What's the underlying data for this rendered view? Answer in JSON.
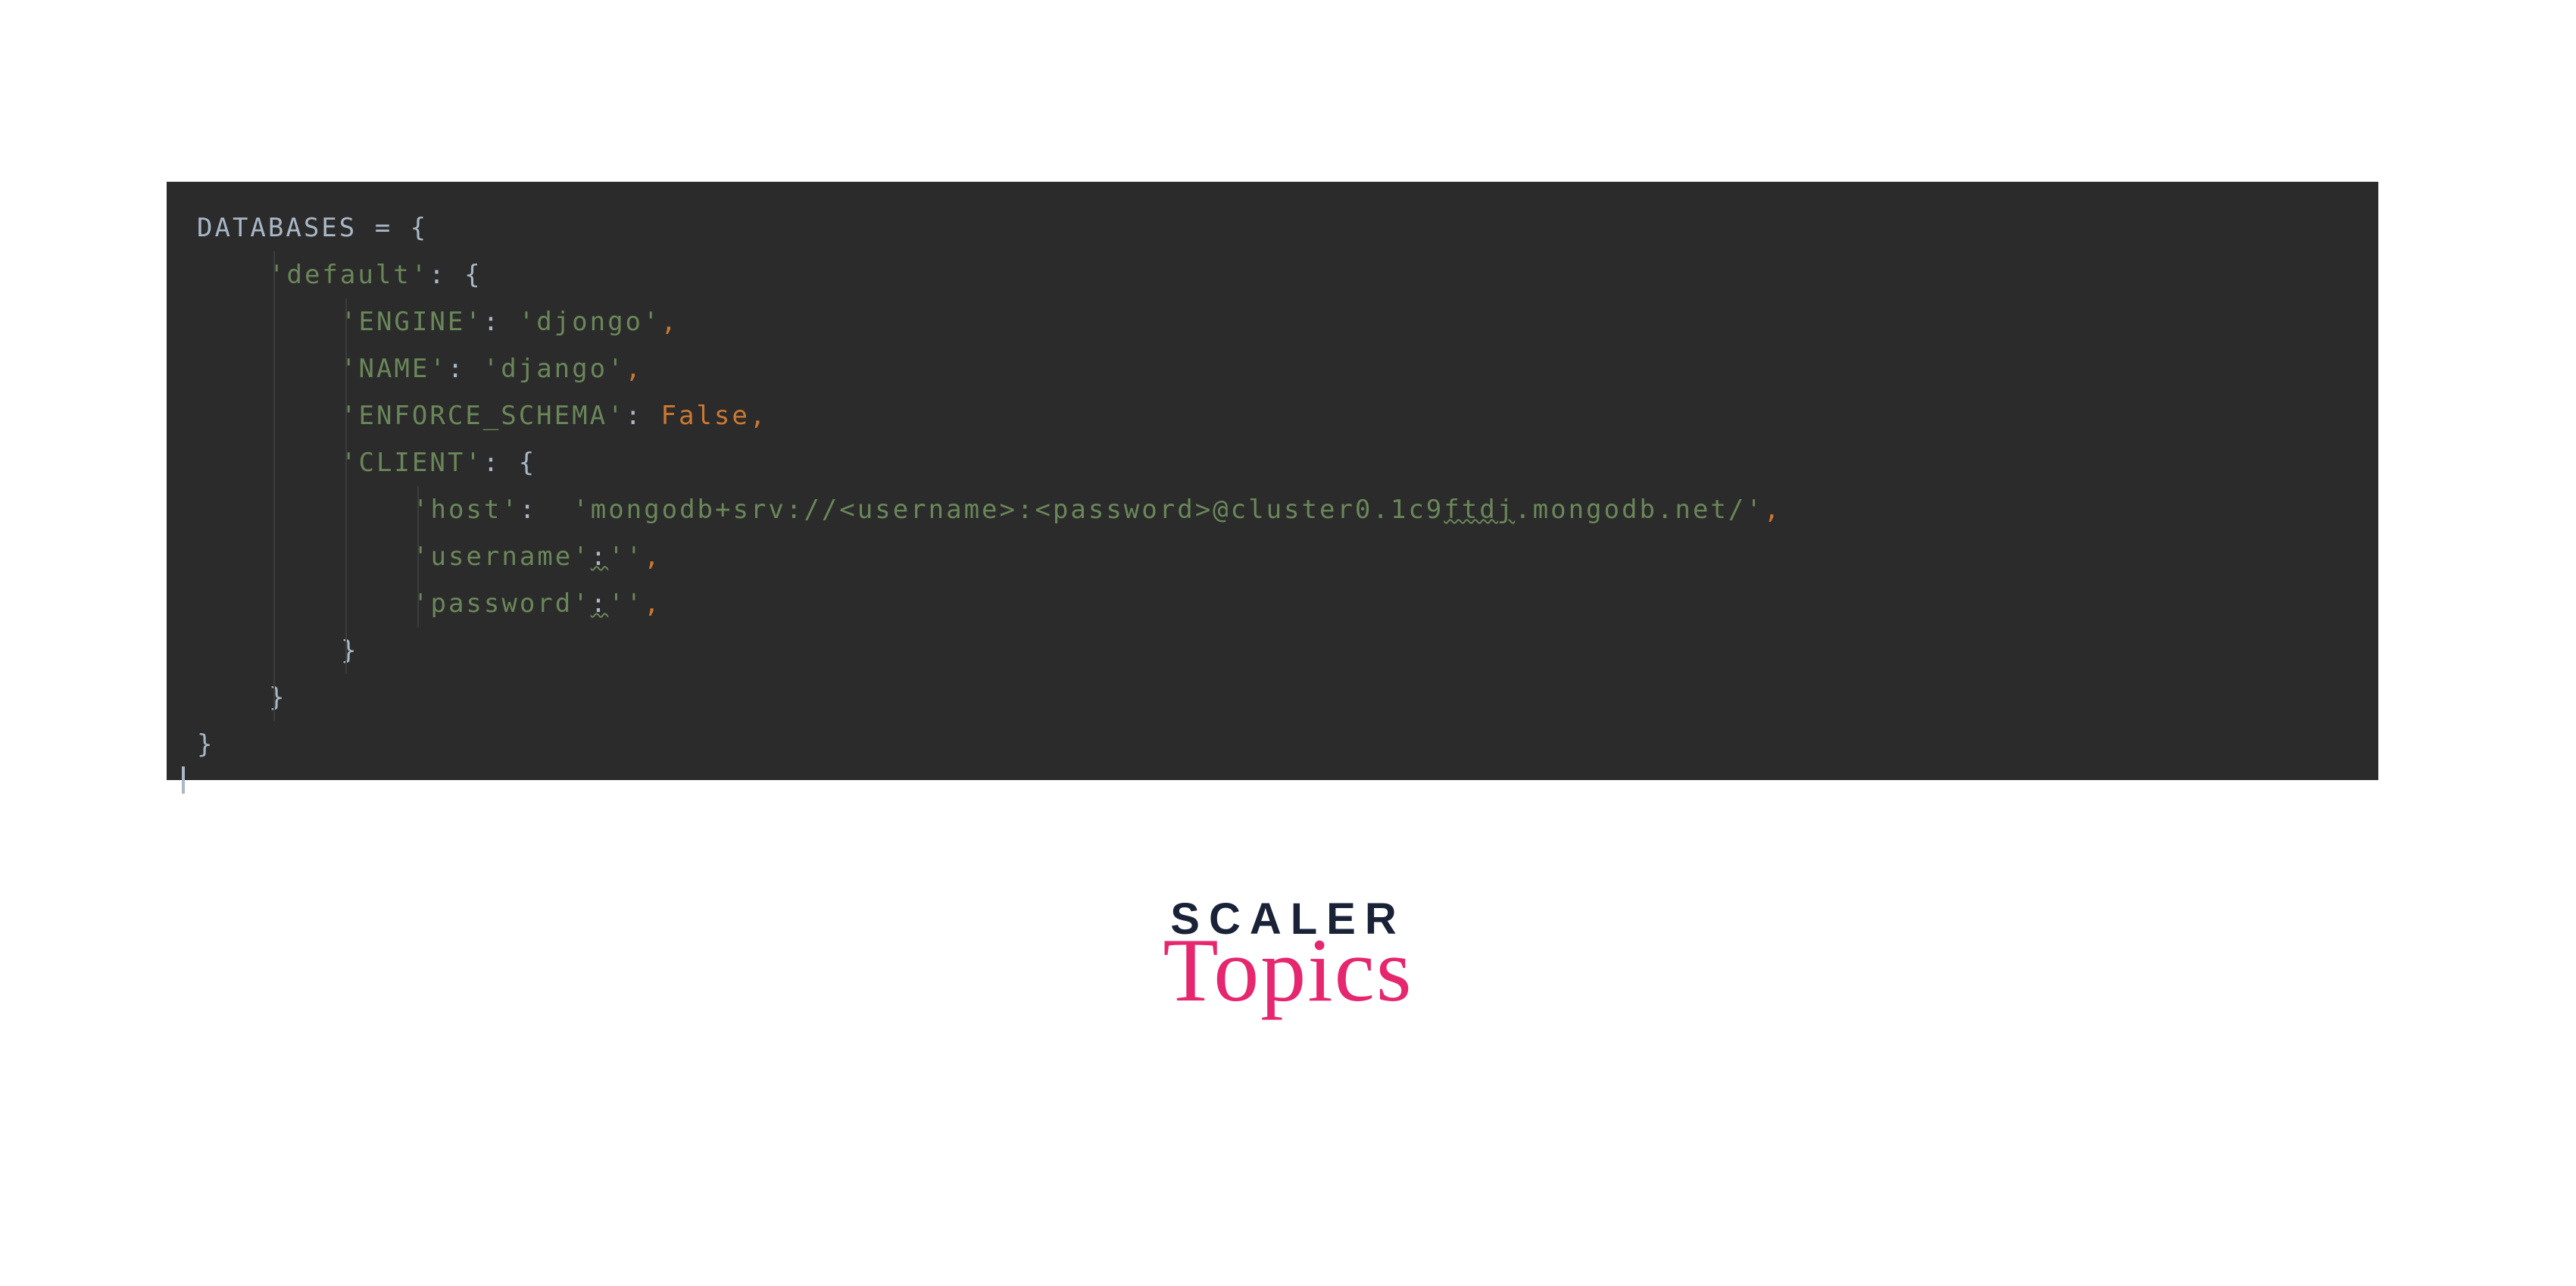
{
  "code": {
    "lines": [
      {
        "indent": 0,
        "segments": [
          {
            "cls": "tok-default",
            "text": "DATABASES = {"
          }
        ]
      },
      {
        "indent": 1,
        "segments": [
          {
            "cls": "tok-string",
            "text": "'default'"
          },
          {
            "cls": "tok-default",
            "text": ": {"
          }
        ]
      },
      {
        "indent": 2,
        "segments": [
          {
            "cls": "tok-string",
            "text": "'ENGINE'"
          },
          {
            "cls": "tok-default",
            "text": ": "
          },
          {
            "cls": "tok-string",
            "text": "'djongo'"
          },
          {
            "cls": "tok-keyword",
            "text": ","
          }
        ]
      },
      {
        "indent": 2,
        "segments": [
          {
            "cls": "tok-string",
            "text": "'NAME'"
          },
          {
            "cls": "tok-default",
            "text": ": "
          },
          {
            "cls": "tok-string",
            "text": "'django'"
          },
          {
            "cls": "tok-keyword",
            "text": ","
          }
        ]
      },
      {
        "indent": 2,
        "segments": [
          {
            "cls": "tok-string",
            "text": "'ENFORCE_SCHEMA'"
          },
          {
            "cls": "tok-default",
            "text": ": "
          },
          {
            "cls": "tok-keyword",
            "text": "False,"
          }
        ]
      },
      {
        "indent": 2,
        "segments": [
          {
            "cls": "tok-string",
            "text": "'CLIENT'"
          },
          {
            "cls": "tok-default",
            "text": ": {"
          }
        ]
      },
      {
        "indent": 3,
        "segments": [
          {
            "cls": "tok-string",
            "text": "'host'"
          },
          {
            "cls": "tok-default",
            "text": ":  "
          },
          {
            "cls": "tok-string",
            "text": "'mongodb+srv://<username>:<password>@cluster0.1c9"
          },
          {
            "cls": "tok-string underline-wavy",
            "text": "ftdj"
          },
          {
            "cls": "tok-string",
            "text": ".mongodb.net/'"
          },
          {
            "cls": "tok-keyword",
            "text": ","
          }
        ]
      },
      {
        "indent": 3,
        "segments": [
          {
            "cls": "tok-string",
            "text": "'username'"
          },
          {
            "cls": "tok-default underline-wavy",
            "text": ":"
          },
          {
            "cls": "tok-string",
            "text": "''"
          },
          {
            "cls": "tok-keyword",
            "text": ","
          }
        ]
      },
      {
        "indent": 3,
        "segments": [
          {
            "cls": "tok-string",
            "text": "'password'"
          },
          {
            "cls": "tok-default underline-wavy",
            "text": ":"
          },
          {
            "cls": "tok-string",
            "text": "''"
          },
          {
            "cls": "tok-keyword",
            "text": ","
          }
        ]
      },
      {
        "indent": 2,
        "segments": [
          {
            "cls": "tok-default",
            "text": "}"
          }
        ]
      },
      {
        "indent": 1,
        "segments": [
          {
            "cls": "tok-default",
            "text": "}"
          }
        ]
      },
      {
        "indent": 0,
        "segments": [
          {
            "cls": "tok-default",
            "text": "}"
          }
        ]
      }
    ]
  },
  "logo": {
    "line1": "SCALER",
    "line2": "Topics"
  }
}
